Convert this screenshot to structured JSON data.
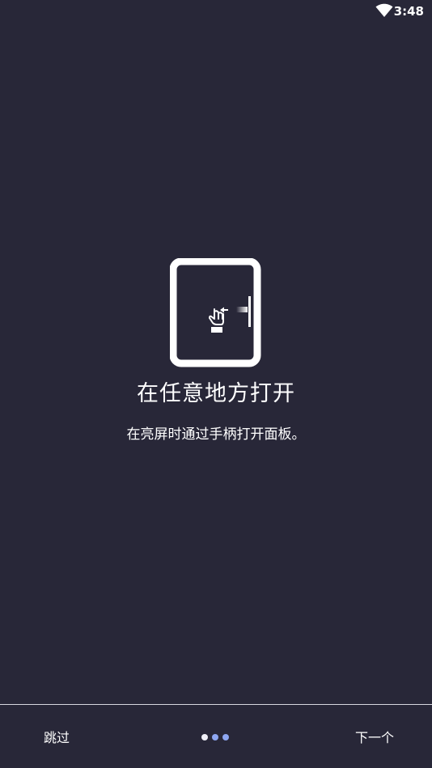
{
  "status_bar": {
    "time": "3:48",
    "wifi_icon": "wifi-icon"
  },
  "illustration": {
    "icon": "tablet-swipe-icon"
  },
  "content": {
    "title": "在任意地方打开",
    "subtitle": "在亮屏时通过手柄打开面板。"
  },
  "footer": {
    "skip_label": "跳过",
    "next_label": "下一个",
    "pagination": {
      "total": 3,
      "active_index": 0
    }
  },
  "colors": {
    "background": "#282738",
    "dot_active": "#f0f0f8",
    "dot_inactive": "#8ea6f2"
  }
}
